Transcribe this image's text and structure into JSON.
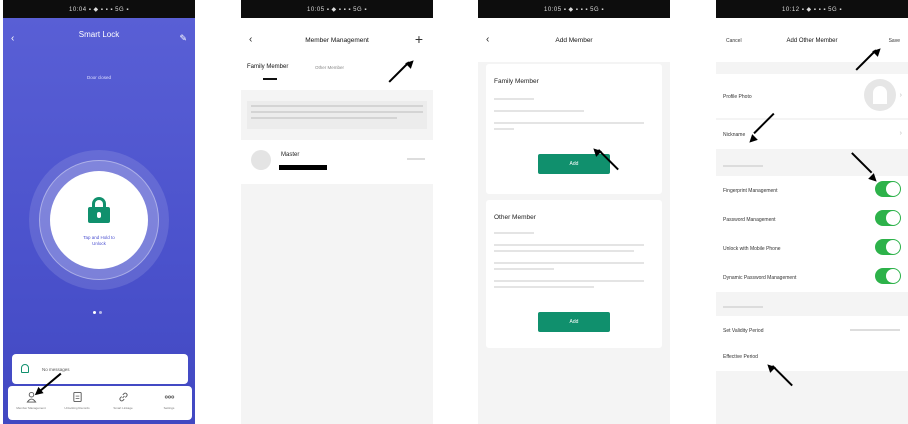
{
  "screens": {
    "home": {
      "status": "10:04 ▪ ◆ ▪ ▪ ▪ 5G ▪",
      "title": "Smart Lock",
      "subtitle": "",
      "door": "Door closed",
      "unlock_line1": "Tap and Hold to",
      "unlock_line2": "Unlock",
      "message": "No messages",
      "nav": [
        "Member Management",
        "Unlocking Records",
        "Smart Linkage",
        "Settings"
      ]
    },
    "members": {
      "status": "10:05 ▪ ◆ ▪ ▪ ▪ 5G ▪",
      "title": "Member Management",
      "tab_family": "Family Member",
      "tab_other": "Other Member",
      "member_name": "Master"
    },
    "add_member": {
      "status": "10:05 ▪ ◆ ▪ ▪ ▪ 5G ▪",
      "title": "Add Member",
      "family_heading": "Family Member",
      "other_heading": "Other Member",
      "add_label": "Add"
    },
    "add_other": {
      "status": "10:12 ▪ ◆ ▪ ▪ ▪ 5G ▪",
      "cancel": "Cancel",
      "title": "Add Other Member",
      "save": "Save",
      "profile_photo": "Profile Photo",
      "nickname": "Nickname",
      "perm_fingerprint": "Fingerprint Management",
      "perm_password": "Password Management",
      "perm_mobile": "Unlock with Mobile Phone",
      "perm_dynamic": "Dynamic Password Management",
      "validity": "Set Validity Period",
      "effective": "Effective Period"
    }
  },
  "colors": {
    "home_bg": "#4b52cc",
    "accent_green": "#10906d",
    "toggle_on": "#2db24a"
  }
}
